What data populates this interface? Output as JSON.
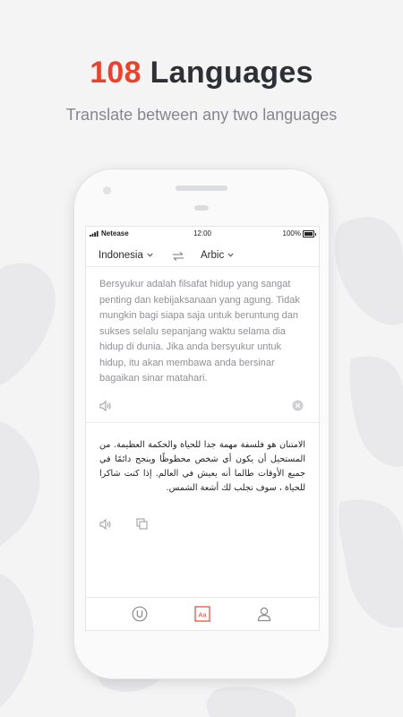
{
  "promo": {
    "headline_number": "108",
    "headline_text": " Languages",
    "subtitle": "Translate between any two languages"
  },
  "status_bar": {
    "carrier": "Netease",
    "time": "12:00",
    "battery": "100%"
  },
  "language_bar": {
    "source": "Indonesia",
    "target": "Arbic"
  },
  "source_text": "Bersyukur adalah filsafat hidup yang sangat penting dan kebijaksanaan yang agung. Tidak mungkin bagi siapa saja untuk beruntung dan sukses selalu sepanjang waktu selama dia hidup di dunia. Jika anda bersyukur untuk hidup, itu akan membawa anda bersinar bagaikan sinar matahari.",
  "translated_text": "الامتنان هو فلسفة مهمة جدا للحياة والحكمة العظيمة. من المستحيل أن يكون أي شخص محظوظًا وينجح دائمًا في جميع الأوقات طالما أنه يعيش في العالم. إذا كنت شاكرا للحياة ، سوف تجلب لك أشعة الشمس.",
  "tab_bar": {
    "active_tab": "Aa",
    "aa_label": "Aa"
  },
  "colors": {
    "accent": "#e8432f",
    "heading": "#2f3036",
    "subtitle": "#85878d"
  },
  "icons": [
    "speaker-icon",
    "clear-icon",
    "copy-icon",
    "swap-icon",
    "u-tab-icon",
    "aa-tab-icon",
    "user-icon",
    "chevron-down-icon"
  ]
}
